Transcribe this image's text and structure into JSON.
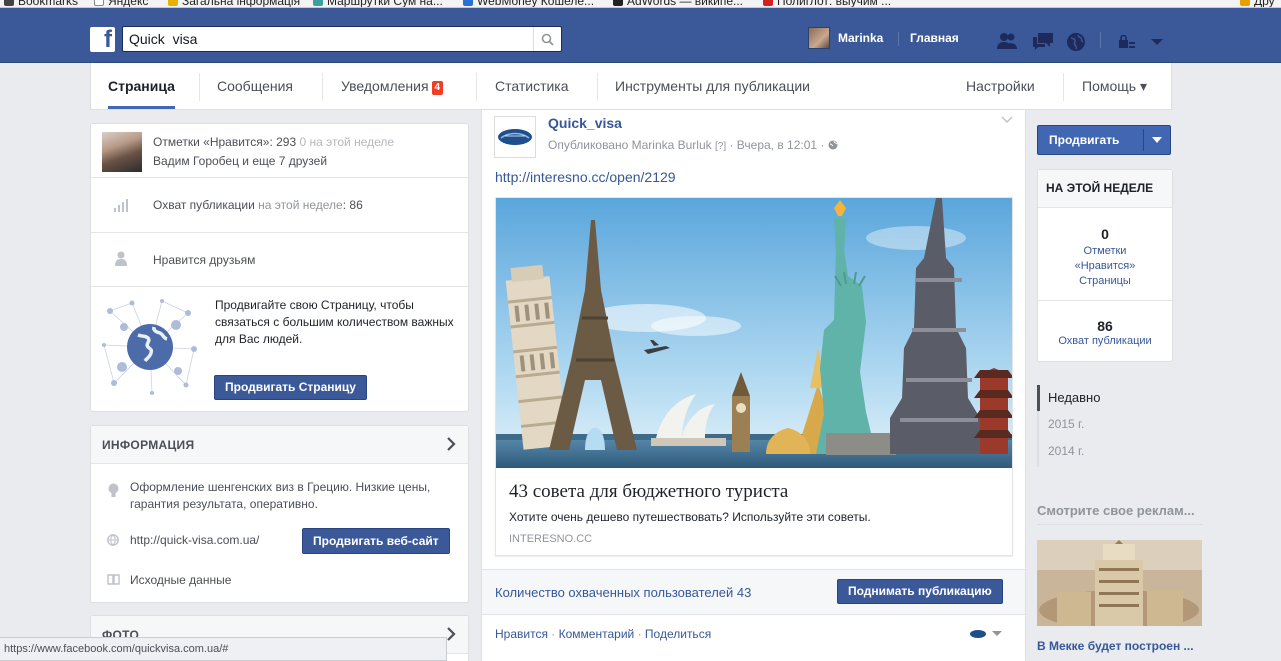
{
  "bookmarks": [
    {
      "label": "Bookmarks",
      "color": "#1a1a1a"
    },
    {
      "label": "Яндекс",
      "color": "#ffffff"
    },
    {
      "label": "Загальна інформація",
      "color": "#e8b000"
    },
    {
      "label": "Маршрутки Сум на...",
      "color": "#3aa0a0"
    },
    {
      "label": "WebMoney Кошеле...",
      "color": "#2a6fd6"
    },
    {
      "label": "AdWords — википе...",
      "color": "#222222"
    },
    {
      "label": "Полиглот: выучим ...",
      "color": "#d42020"
    },
    {
      "label": "Дру",
      "color": "#e8a000"
    }
  ],
  "header": {
    "search_value": "Quick  visa",
    "user_name": "Marinka",
    "home_label": "Главная",
    "brand_color": "#3b5998"
  },
  "nav": {
    "items": [
      "Страница",
      "Сообщения",
      "Уведомления",
      "Статистика",
      "Инструменты для публикации"
    ],
    "notif_badge": "4",
    "settings": "Настройки",
    "help": "Помощь ▾"
  },
  "left": {
    "likes_label": "Отметки «Нравится»:",
    "likes_count": "293",
    "likes_week": "0",
    "likes_week_label": "на этой неделе",
    "likes_friends": "Вадим Горобец и еще 7 друзей",
    "reach_label": "Охват публикации",
    "reach_week_label": "на этой неделе",
    "reach_count": "86",
    "friends_like": "Нравится друзьям",
    "promo_text": "Продвигайте свою Страницу, чтобы связаться с большим количеством важных для Вас людей.",
    "promo_button": "Продвигать Страницу",
    "info_title": "ИНФОРМАЦИЯ",
    "info_desc": "Оформление шенгенских виз в Грецию. Низкие цены, гарантия результата, оперативно.",
    "website": "http://quick-visa.com.ua/",
    "website_button": "Продвигать веб-сайт",
    "source_data": "Исходные данные",
    "photo_title": "ФОТО"
  },
  "post": {
    "page_name": "Quick_visa",
    "published_by": "Опубликовано Marinka Burluk",
    "help_mark": "[?]",
    "time": "Вчера, в 12:01",
    "link": "http://interesno.cc/open/2129",
    "card_title": "43 совета для бюджетного туриста",
    "card_desc": "Хотите очень дешево путешествовать? Используйте эти советы.",
    "card_domain": "INTERESNO.CC",
    "reach_text": "Количество охваченных пользователей 43",
    "boost_button": "Поднимать публикацию",
    "actions": [
      "Нравится",
      "Комментарий",
      "Поделиться"
    ]
  },
  "right": {
    "promote_button": "Продвигать",
    "week_title": "НА ЭТОЙ НЕДЕЛЕ",
    "week_likes_value": "0",
    "week_likes_label": "Отметки «Нравится» Страницы",
    "week_reach_value": "86",
    "week_reach_label": "Охват публикации",
    "timeline": [
      "Недавно",
      "2015 г.",
      "2014 г."
    ],
    "ad_title": "Смотрите свое реклам...",
    "ad_caption": "В Мекке будет построен ..."
  },
  "status_url": "https://www.facebook.com/quickvisa.com.ua/#"
}
